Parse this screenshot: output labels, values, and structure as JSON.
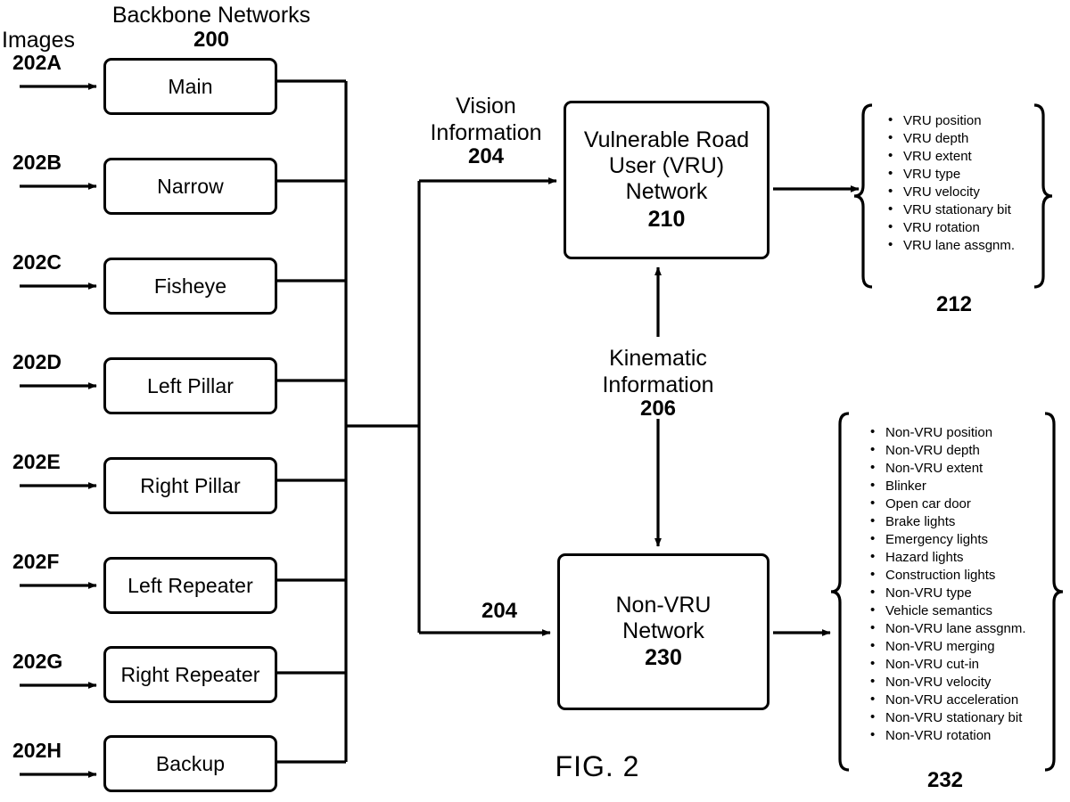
{
  "figure": {
    "caption": "FIG. 2"
  },
  "headers": {
    "images_label": "Images",
    "backbone_label": "Backbone Networks",
    "backbone_ref": "200"
  },
  "backbone_networks": [
    {
      "ref": "202A",
      "label": "Main"
    },
    {
      "ref": "202B",
      "label": "Narrow"
    },
    {
      "ref": "202C",
      "label": "Fisheye"
    },
    {
      "ref": "202D",
      "label": "Left Pillar"
    },
    {
      "ref": "202E",
      "label": "Right Pillar"
    },
    {
      "ref": "202F",
      "label": "Left Repeater"
    },
    {
      "ref": "202G",
      "label": "Right Repeater"
    },
    {
      "ref": "202H",
      "label": "Backup"
    }
  ],
  "signals": {
    "vision_line1": "Vision",
    "vision_line2": "Information",
    "vision_ref": "204",
    "vision_ref_lower": "204",
    "kinematic_line1": "Kinematic",
    "kinematic_line2": "Information",
    "kinematic_ref": "206"
  },
  "vru_network": {
    "line1": "Vulnerable Road",
    "line2": "User (VRU)",
    "line3": "Network",
    "ref": "210"
  },
  "nonvru_network": {
    "line1": "Non-VRU",
    "line2": "Network",
    "ref": "230"
  },
  "vru_outputs": {
    "ref": "212",
    "items": [
      "VRU position",
      "VRU depth",
      "VRU extent",
      "VRU type",
      "VRU velocity",
      "VRU stationary bit",
      "VRU rotation",
      "VRU lane assgnm."
    ]
  },
  "nonvru_outputs": {
    "ref": "232",
    "items": [
      "Non-VRU position",
      "Non-VRU depth",
      "Non-VRU extent",
      "Blinker",
      "Open car door",
      "Brake lights",
      "Emergency lights",
      "Hazard lights",
      "Construction lights",
      "Non-VRU type",
      "Vehicle semantics",
      "Non-VRU lane assgnm.",
      "Non-VRU merging",
      "Non-VRU cut-in",
      "Non-VRU velocity",
      "Non-VRU acceleration",
      "Non-VRU stationary bit",
      "Non-VRU rotation"
    ]
  },
  "colors": {
    "ink": "#000000",
    "paper": "#ffffff"
  }
}
